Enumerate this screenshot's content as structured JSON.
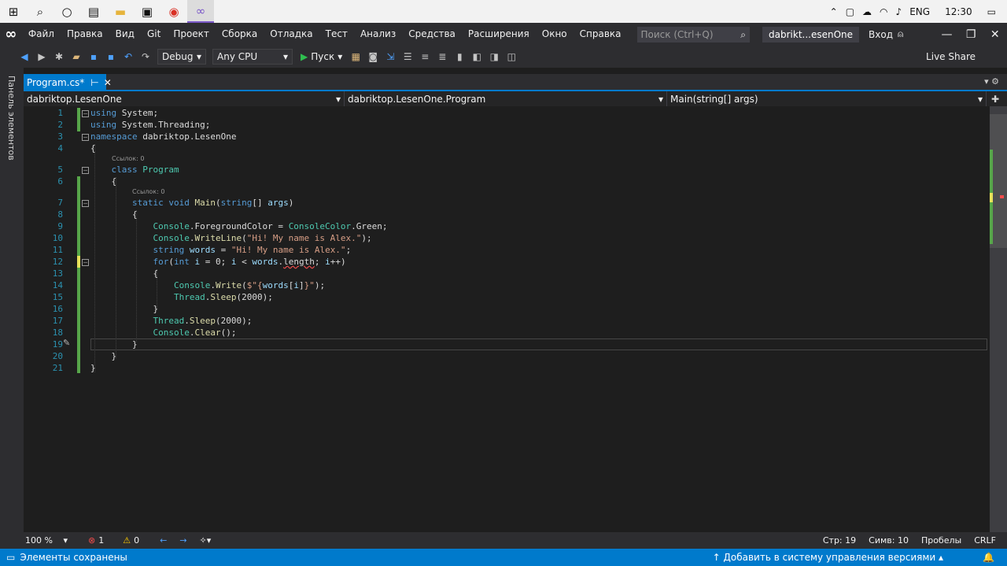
{
  "taskbar": {
    "lang": "ENG",
    "time": "12:30"
  },
  "menubar": {
    "items": [
      "Файл",
      "Правка",
      "Вид",
      "Git",
      "Проект",
      "Сборка",
      "Отладка",
      "Тест",
      "Анализ",
      "Средства",
      "Расширения",
      "Окно",
      "Справка"
    ],
    "search_placeholder": "Поиск (Ctrl+Q)",
    "solution": "dabrikt...esenOne",
    "signin": "Вход"
  },
  "toolbar": {
    "config": "Debug",
    "platform": "Any CPU",
    "run": "Пуск",
    "live_share": "Live Share"
  },
  "sidebar": {
    "label": "Панель элементов"
  },
  "tab": {
    "label": "Program.cs*"
  },
  "nav": {
    "project": "dabriktop.LesenOne",
    "class": "dabriktop.LesenOne.Program",
    "member": "Main(string[] args)"
  },
  "code": {
    "refs": "Ссылок: 0",
    "line_numbers": [
      "1",
      "2",
      "3",
      "4",
      "5",
      "6",
      "7",
      "8",
      "9",
      "10",
      "11",
      "12",
      "13",
      "14",
      "15",
      "16",
      "17",
      "18",
      "19",
      "20",
      "21"
    ]
  },
  "status": {
    "zoom": "100 %",
    "errors": "1",
    "warnings": "0",
    "line": "Стр: 19",
    "col": "Симв: 10",
    "ws": "Пробелы",
    "eol": "CRLF"
  },
  "bottom": {
    "saved": "Элементы сохранены",
    "vcs": "Добавить в систему управления версиями"
  },
  "colors": {
    "accent": "#007acc",
    "keyword": "#569cd6",
    "type": "#4ec9b0",
    "string": "#d69d85"
  }
}
